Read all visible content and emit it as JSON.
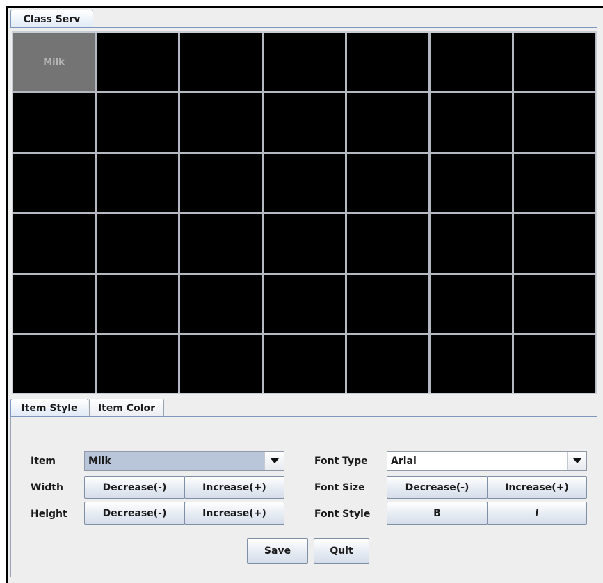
{
  "window": {
    "tab_label": "Class Serv"
  },
  "grid": {
    "rows": 6,
    "columns": 7,
    "cells": [
      {
        "label": "Milk",
        "active": true
      }
    ]
  },
  "bottom_tabs": [
    {
      "label": "Item Style",
      "selected": true
    },
    {
      "label": "Item Color",
      "selected": false
    }
  ],
  "form": {
    "item_label": "Item",
    "item_value": "Milk",
    "width_label": "Width",
    "height_label": "Height",
    "decrease_label": "Decrease(-)",
    "increase_label": "Increase(+)",
    "font_type_label": "Font Type",
    "font_type_value": "Arial",
    "font_size_label": "Font Size",
    "font_style_label": "Font Style",
    "bold_label": "B",
    "italic_label": "I"
  },
  "actions": {
    "save_label": "Save",
    "quit_label": "Quit"
  },
  "colors": {
    "cell_empty": "#000000",
    "cell_active": "#747474",
    "selection_highlight": "#b9c5d8"
  }
}
